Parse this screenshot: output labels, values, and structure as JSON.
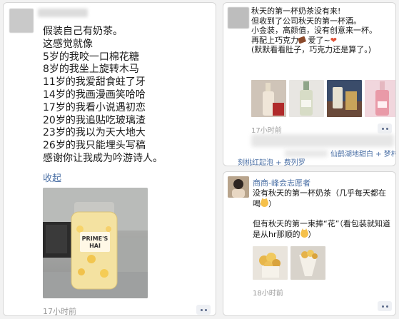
{
  "post_left": {
    "lines": [
      "假装自己有奶茶。",
      "这感觉就像",
      "5岁的我咬一口棉花糖",
      "8岁的我坐上旋转木马",
      "11岁的我爱甜食蛀了牙",
      "14岁的我画漫画笑哈哈",
      "17岁的我看小说遇初恋",
      "20岁的我追贴吃玻璃渣",
      "23岁的我以为天大地大",
      "26岁的我只能埋头写稿",
      "感谢你让我成为吟游诗人。"
    ],
    "collapse_label": "收起",
    "bottle_label_1": "PRIME'S",
    "bottle_label_2": "HAI",
    "time": "17小时前"
  },
  "post_right_top": {
    "lines": [
      "秋天的第一杯奶茶没有来!",
      "但收到了公司秋天的第一杯酒。",
      "小金装，高颜值，没有创意来一杯。",
      "再配上巧克力",
      "爱了~",
      "(默默看看肚子，巧克力还是算了。)"
    ],
    "time": "17小时前",
    "tagline_a": "仙鹤湖地甜白 + 梦村",
    "tagline_b": "刻桃红起泡 + 费列罗"
  },
  "post_right_bottom": {
    "name": "商商-峰会志愿者",
    "para1": "没有秋天的第一杯奶茶（几乎每天都在喝",
    "para1_end": "）",
    "para2": "但有秋天的第一束捧“花”（看包装就知道是从hr那顺的",
    "para2_end": "）",
    "time": "18小时前"
  },
  "colors": {
    "link": "#4a6fa5",
    "time": "#9a9a9a",
    "more_dots": "#5b6a8a"
  }
}
